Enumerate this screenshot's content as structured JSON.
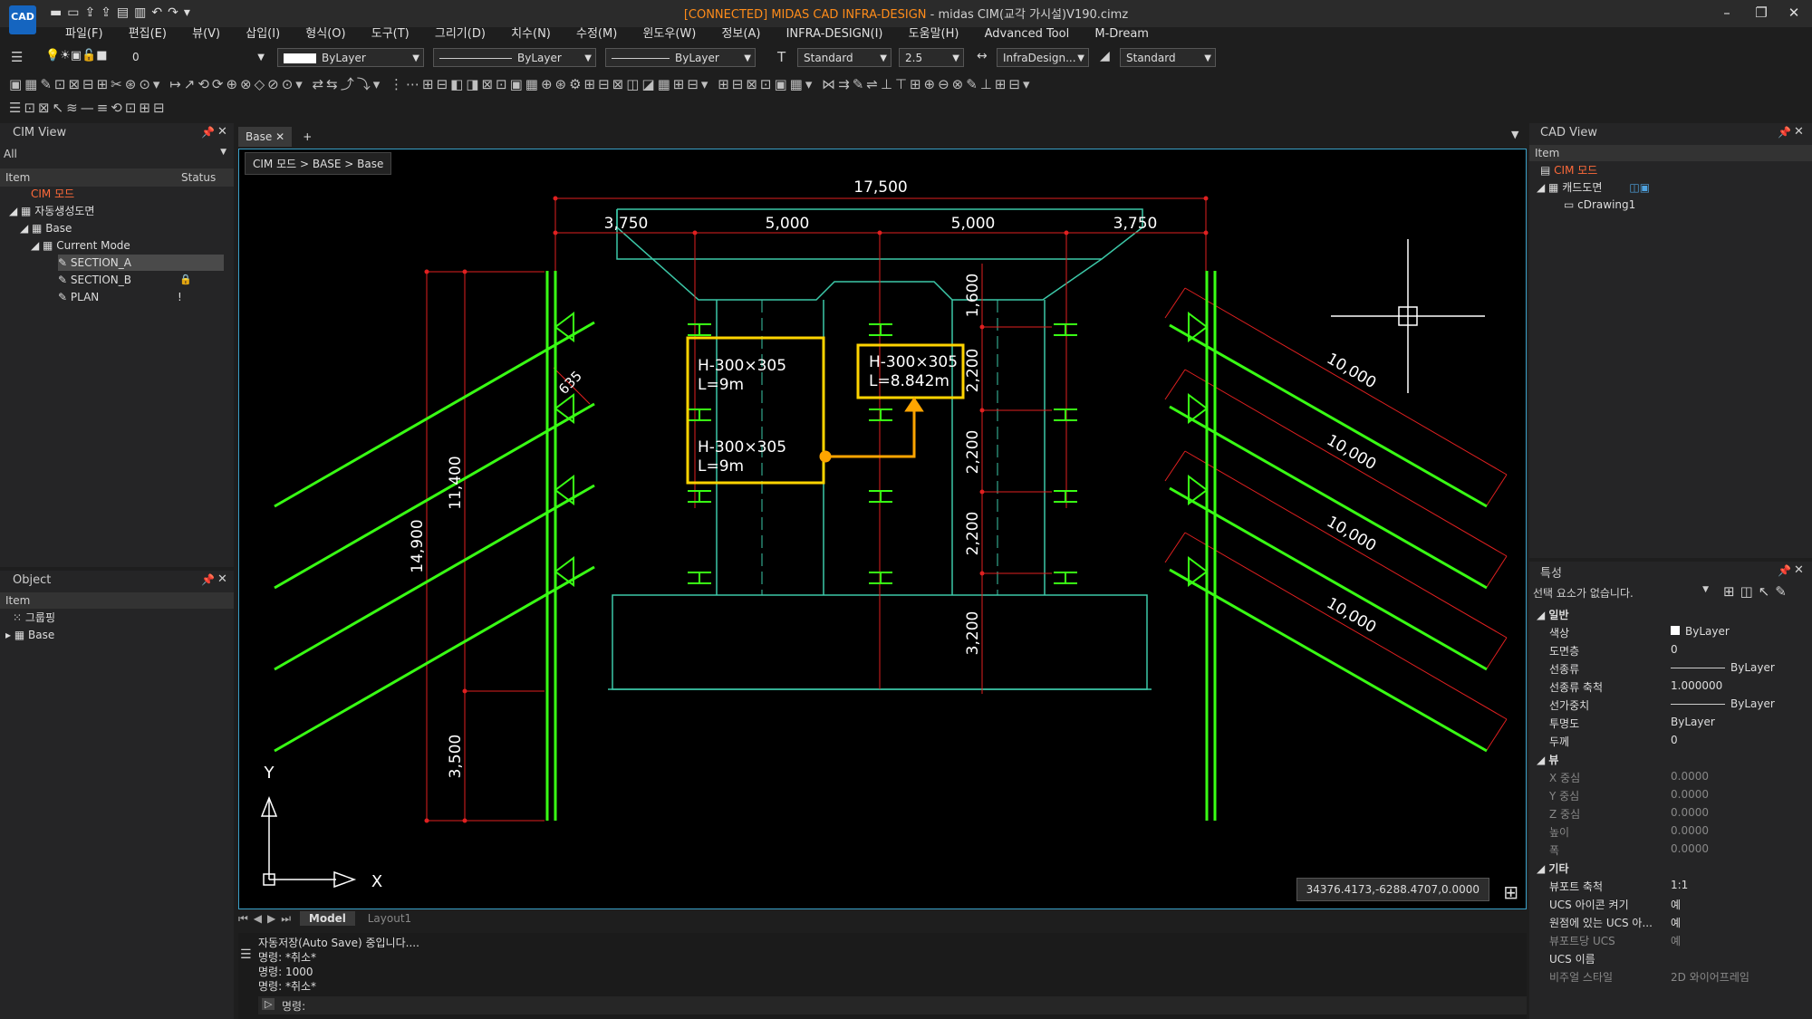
{
  "app": {
    "logo": "CAD",
    "title_connected": "[CONNECTED] MIDAS CAD INFRA-DESIGN",
    "title_rest": " - midas CIM(교각 가시설)V190.cimz"
  },
  "menu": [
    "파일(F)",
    "편집(E)",
    "뷰(V)",
    "삽입(I)",
    "형식(O)",
    "도구(T)",
    "그리기(D)",
    "치수(N)",
    "수정(M)",
    "윈도우(W)",
    "정보(A)",
    "INFRA-DESIGN(I)",
    "도움말(H)",
    "Advanced Tool",
    "M-Dream"
  ],
  "properties_toolbar": {
    "layer": "0",
    "color": "ByLayer",
    "linetype": "ByLayer",
    "lineweight": "ByLayer",
    "text_style": "Standard",
    "text_height": "2.5",
    "dim_style": "InfraDesign...",
    "table_style": "Standard"
  },
  "cim_view": {
    "title": "CIM View",
    "filter": "All",
    "col_item": "Item",
    "col_status": "Status",
    "root": "CIM 모드",
    "tree": [
      "자동생성도면",
      "Base",
      "Current Mode",
      "SECTION_A",
      "SECTION_B",
      "PLAN"
    ],
    "plan_status": "!"
  },
  "object_panel": {
    "title": "Object",
    "col_item": "Item",
    "items": [
      "그룹핑",
      "Base"
    ]
  },
  "doc_tab": {
    "label": "Base",
    "breadcrumb": "CIM 모드 > BASE > Base"
  },
  "drawing": {
    "dims": {
      "total_width": "17,500",
      "seg1": "3,750",
      "seg2": "5,000",
      "seg3": "5,000",
      "seg4": "3,750",
      "left_height": "14,900",
      "left_upper": "11,400",
      "left_lower": "3,500",
      "small": "635",
      "v1": "1,600",
      "v2": "2,200",
      "v3": "2,200",
      "v4": "2,200",
      "v5": "3,200",
      "anchor": "10,000"
    },
    "callout1": {
      "line1": "H-300×305",
      "line2": "L=9m",
      "line3": "H-300×305",
      "line4": "L=9m"
    },
    "callout2": {
      "line1": "H-300×305",
      "line2": "L=8.842m"
    },
    "axis_x": "X",
    "axis_y": "Y"
  },
  "coords": "34376.4173,-6288.4707,0.0000",
  "layout_tabs": [
    "Model",
    "Layout1"
  ],
  "command_lines": [
    "자동저장(Auto Save) 중입니다....",
    "명령: *취소*",
    "명령: 1000",
    "명령: *취소*"
  ],
  "command_prompt": "명령:",
  "cad_view": {
    "title": "CAD View",
    "col_item": "Item",
    "root": "CIM 모드",
    "child": "캐드도면",
    "leaf": "cDrawing1"
  },
  "props_panel": {
    "title": "특성",
    "selection": "선택 요소가 없습니다.",
    "sections": {
      "general": "일반",
      "view": "뷰",
      "misc": "기타"
    },
    "general": [
      {
        "k": "색상",
        "v": "ByLayer"
      },
      {
        "k": "도면층",
        "v": "0"
      },
      {
        "k": "선종류",
        "v": "ByLayer"
      },
      {
        "k": "선종류 축척",
        "v": "1.000000"
      },
      {
        "k": "선가중치",
        "v": "ByLayer"
      },
      {
        "k": "투명도",
        "v": "ByLayer"
      },
      {
        "k": "두께",
        "v": "0"
      }
    ],
    "view": [
      {
        "k": "X 중심",
        "v": "0.0000"
      },
      {
        "k": "Y 중심",
        "v": "0.0000"
      },
      {
        "k": "Z 중심",
        "v": "0.0000"
      },
      {
        "k": "높이",
        "v": "0.0000"
      },
      {
        "k": "폭",
        "v": "0.0000"
      }
    ],
    "misc": [
      {
        "k": "뷰포트 축척",
        "v": "1:1"
      },
      {
        "k": "UCS 아이콘 켜기",
        "v": "예"
      },
      {
        "k": "원점에 있는 UCS 아...",
        "v": "예"
      },
      {
        "k": "뷰포트당 UCS",
        "v": "예"
      },
      {
        "k": "UCS 이름",
        "v": ""
      },
      {
        "k": "비주얼 스타일",
        "v": "2D 와이어프레임"
      }
    ]
  },
  "colors": {
    "accent": "#3aa0c8",
    "highlight": "#ff8c1a",
    "callout": "#ffd400",
    "dim": "#e02020",
    "green": "#39ff14",
    "cyan": "#3cc8a8"
  }
}
